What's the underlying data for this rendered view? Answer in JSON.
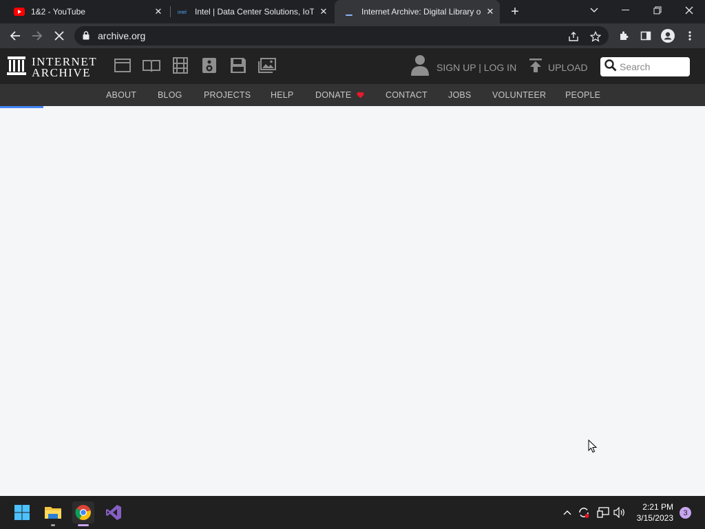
{
  "browser": {
    "tabs": [
      {
        "title": "1&2 - YouTube",
        "favicon": "youtube-icon"
      },
      {
        "title": "Intel | Data Center Solutions, IoT,",
        "favicon": "intel-icon"
      },
      {
        "title": "Internet Archive: Digital Library o",
        "favicon": "loading-icon"
      }
    ],
    "url": "archive.org"
  },
  "ia": {
    "logo_line1": "INTERNET",
    "logo_line2": "ARCHIVE",
    "user_label": "SIGN UP | LOG IN",
    "upload_label": "UPLOAD",
    "search_placeholder": "Search",
    "nav": [
      "ABOUT",
      "BLOG",
      "PROJECTS",
      "HELP",
      "DONATE",
      "CONTACT",
      "JOBS",
      "VOLUNTEER",
      "PEOPLE"
    ]
  },
  "taskbar": {
    "time": "2:21 PM",
    "date": "3/15/2023",
    "notification_count": "3"
  },
  "colors": {
    "accent": "#4285f4",
    "donate_heart": "#e8192c"
  }
}
